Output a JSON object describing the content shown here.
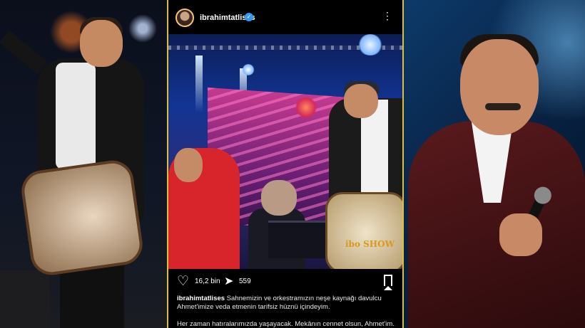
{
  "post": {
    "username": "ibrahimtatlises",
    "verified_badge": "verified-icon",
    "menu_icon": "more-vertical-icon",
    "likes": "16,2 bin",
    "shares": "559",
    "caption_user": "ibrahimtatlises",
    "caption_text": "Sahnemizin ve orkestramızın neşe kaynağı davulcu Ahmet'imize veda etmenin tarifsiz hüznü içindeyim.",
    "caption_line2": "Her zaman hatıralarımızda yaşayacak. Mekânın cennet olsun, Ahmet'im..",
    "drum_text": "ibo SHOW"
  },
  "colors": {
    "frame": "#d9c23a",
    "verified": "#3897f0",
    "suit_red": "#d7252b"
  }
}
